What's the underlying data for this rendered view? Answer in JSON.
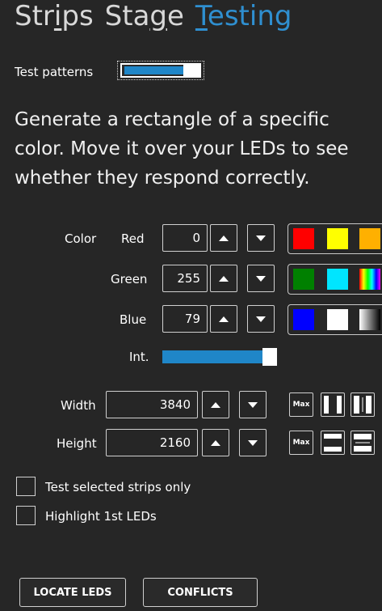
{
  "tabs": [
    {
      "label": "Strips",
      "active": false
    },
    {
      "label": "Stage",
      "active": false
    },
    {
      "label": "Testing",
      "active": true
    }
  ],
  "test_patterns": {
    "label": "Test patterns",
    "enabled": true
  },
  "description": "Generate a rectangle of a specific color. Move it over your LEDs to see whether they respond correctly.",
  "color": {
    "label": "Color",
    "red": {
      "label": "Red",
      "value": "0"
    },
    "green": {
      "label": "Green",
      "value": "255"
    },
    "blue": {
      "label": "Blue",
      "value": "79"
    },
    "intensity": {
      "label": "Int.",
      "value": 0.95
    }
  },
  "swatches": {
    "row1": [
      "#ff0000",
      "#ffff00",
      "#ffb000"
    ],
    "row2": [
      "#008000",
      "#00e5ff",
      "rainbow"
    ],
    "row3": [
      "#0000ff",
      "#ffffff",
      "gradient"
    ]
  },
  "size": {
    "width": {
      "label": "Width",
      "value": "3840"
    },
    "height": {
      "label": "Height",
      "value": "2160"
    },
    "max_label": "Max"
  },
  "options": [
    {
      "label": "Test selected strips only",
      "checked": false
    },
    {
      "label": "Highlight 1st LEDs",
      "checked": false
    }
  ],
  "actions": {
    "locate": "LOCATE LEDS",
    "conflicts": "CONFLICTS"
  }
}
